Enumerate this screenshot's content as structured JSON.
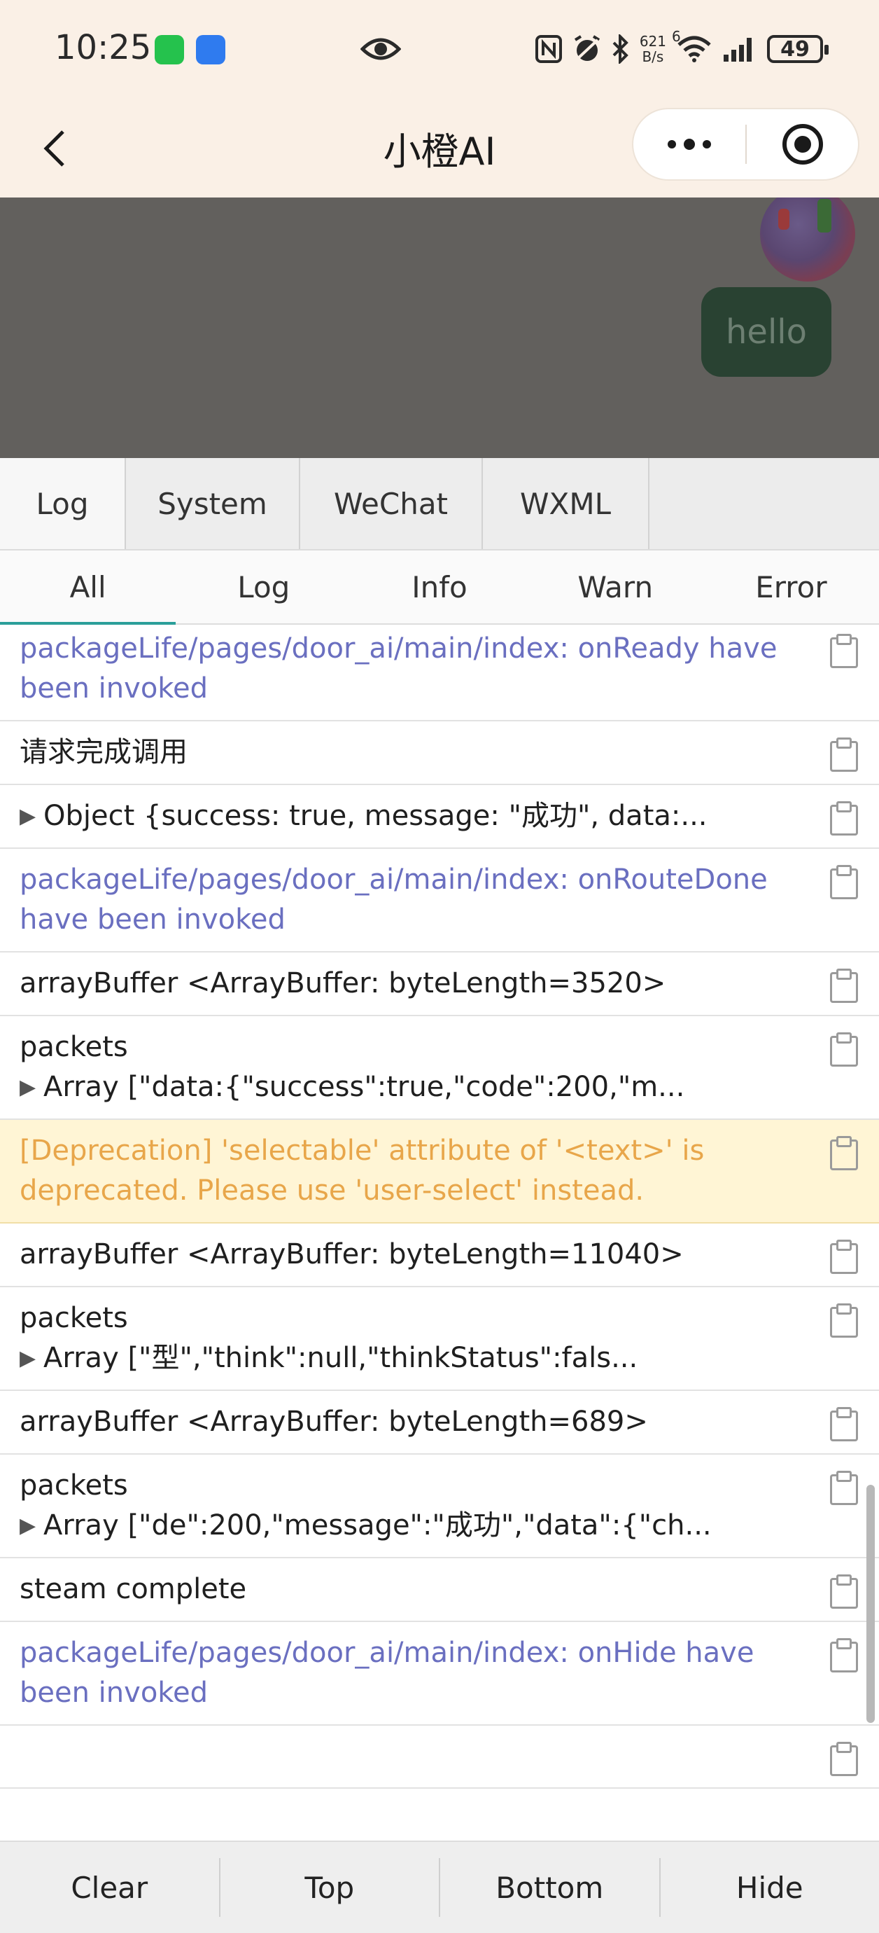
{
  "status_bar": {
    "time": "10:25",
    "net_speed_value": "621",
    "net_speed_unit": "B/s",
    "signal_type": "6",
    "battery": "49",
    "icons": [
      "wechat-icon",
      "app-icon",
      "eye-icon",
      "nfc-icon",
      "alarm-icon",
      "bluetooth-icon",
      "wifi-icon",
      "signal-icon",
      "battery-icon"
    ]
  },
  "nav": {
    "title": "小橙AI",
    "back_icon": "chevron-left-icon",
    "more_icon": "more-icon",
    "close_icon": "target-icon"
  },
  "chat": {
    "message": "hello"
  },
  "console": {
    "tabs": [
      {
        "label": "Log",
        "active": true
      },
      {
        "label": "System",
        "active": false
      },
      {
        "label": "WeChat",
        "active": false
      },
      {
        "label": "WXML",
        "active": false
      }
    ],
    "filters": [
      {
        "label": "All",
        "active": true
      },
      {
        "label": "Log",
        "active": false
      },
      {
        "label": "Info",
        "active": false
      },
      {
        "label": "Warn",
        "active": false
      },
      {
        "label": "Error",
        "active": false
      }
    ],
    "logs": [
      {
        "type": "sys",
        "text": "packageLife/pages/door_ai/main/index: onReady have been invoked"
      },
      {
        "type": "log",
        "text": "请求完成调用"
      },
      {
        "type": "log",
        "expandable": true,
        "text": "Object {success: true, message: \"成功\", data:..."
      },
      {
        "type": "sys",
        "text": "packageLife/pages/door_ai/main/index: onRouteDone have been invoked"
      },
      {
        "type": "log",
        "text": "arrayBuffer <ArrayBuffer: byteLength=3520>"
      },
      {
        "type": "log",
        "title": "packets",
        "expandable": true,
        "text": "Array [\"data:{\"success\":true,\"code\":200,\"m..."
      },
      {
        "type": "warn",
        "text": "[Deprecation] 'selectable' attribute of '<text>' is deprecated. Please use 'user-select' instead."
      },
      {
        "type": "log",
        "text": "arrayBuffer <ArrayBuffer: byteLength=11040>"
      },
      {
        "type": "log",
        "title": "packets",
        "expandable": true,
        "text": "Array [\"型\",\"think\":null,\"thinkStatus\":fals..."
      },
      {
        "type": "log",
        "text": "arrayBuffer <ArrayBuffer: byteLength=689>"
      },
      {
        "type": "log",
        "title": "packets",
        "expandable": true,
        "text": "Array [\"de\":200,\"message\":\"成功\",\"data\":{\"ch..."
      },
      {
        "type": "log",
        "text": "steam complete"
      },
      {
        "type": "sys",
        "text": "packageLife/pages/door_ai/main/index: onHide have been invoked"
      },
      {
        "type": "log",
        "text": ""
      }
    ],
    "actions": [
      "Clear",
      "Top",
      "Bottom",
      "Hide"
    ]
  },
  "colors": {
    "header_bg": "#faf0e6",
    "system_log": "#6a6fc0",
    "warn_bg": "#fff5d5",
    "warn_text": "#e8a64a",
    "chat_bubble": "#294232"
  }
}
